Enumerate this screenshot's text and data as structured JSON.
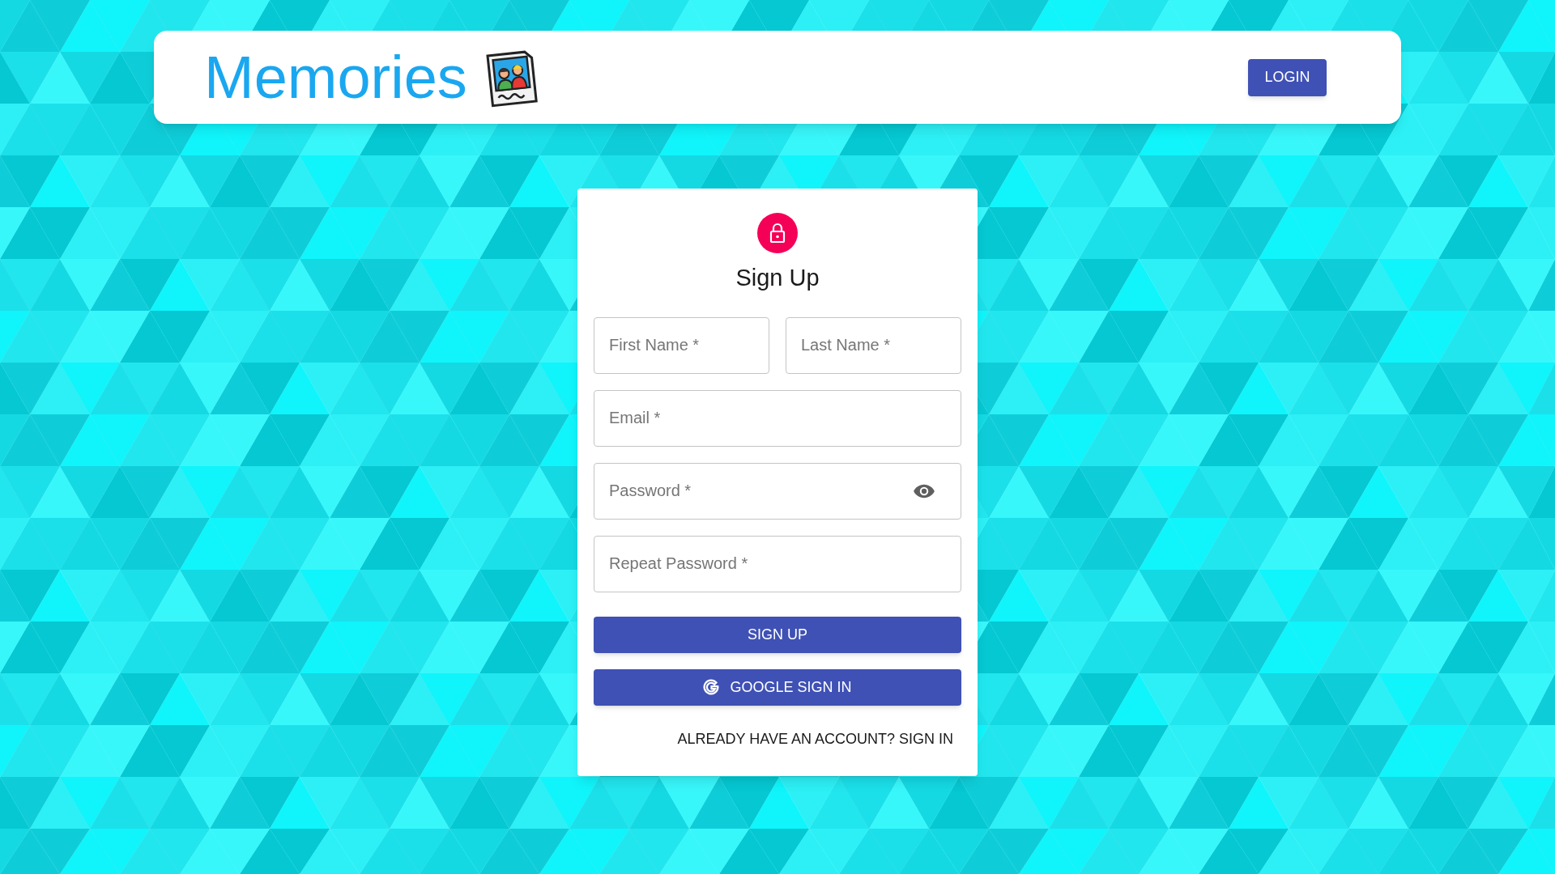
{
  "header": {
    "title": "Memories",
    "login_button": "LOGIN"
  },
  "form": {
    "title": "Sign Up",
    "fields": [
      {
        "placeholder": "First Name *",
        "kind": "text"
      },
      {
        "placeholder": "Last Name *",
        "kind": "text"
      },
      {
        "placeholder": "Email *",
        "kind": "text"
      },
      {
        "placeholder": "Password *",
        "kind": "password"
      },
      {
        "placeholder": "Repeat Password *",
        "kind": "text"
      }
    ],
    "buttons": [
      {
        "label": "SIGN UP",
        "kind": "plain"
      },
      {
        "label": "GOOGLE SIGN IN",
        "kind": "google"
      }
    ],
    "switch_link": "ALREADY HAVE AN ACCOUNT? SIGN IN"
  }
}
